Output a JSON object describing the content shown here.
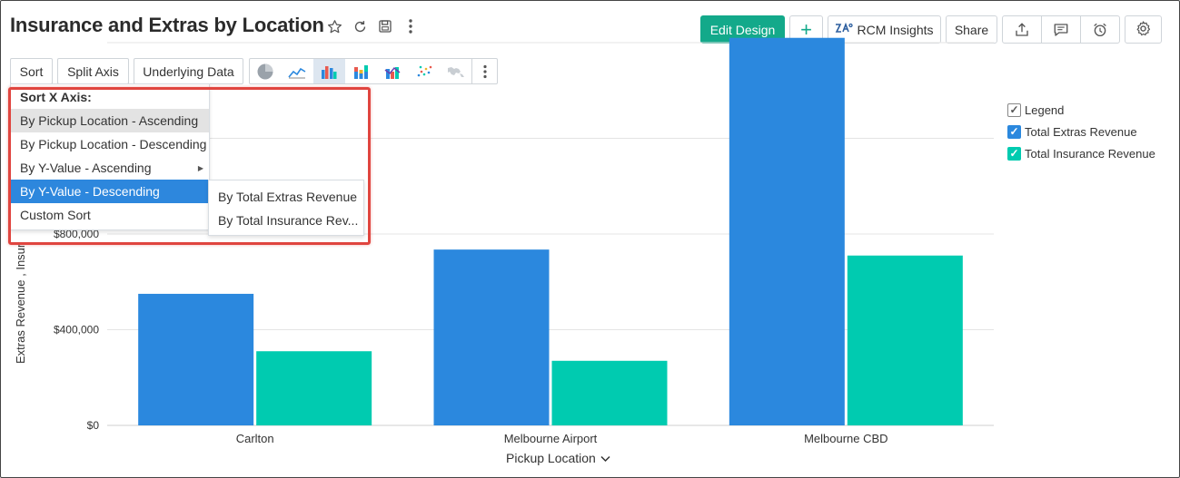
{
  "header": {
    "title": "Insurance and Extras by Location",
    "edit_design": "Edit Design",
    "add_label": "+",
    "rcm_insights": "RCM Insights",
    "share": "Share"
  },
  "toolbar": {
    "sort": "Sort",
    "split_axis": "Split Axis",
    "underlying_data": "Underlying Data"
  },
  "sort_menu": {
    "header": "Sort X Axis:",
    "items": [
      "By Pickup Location - Ascending",
      "By Pickup Location - Descending",
      "By Y-Value - Ascending",
      "By Y-Value - Descending",
      "Custom Sort"
    ],
    "submenu": [
      "By Total Extras Revenue",
      "By Total Insurance Rev..."
    ]
  },
  "legend": {
    "title": "Legend",
    "items": [
      "Total Extras Revenue",
      "Total Insurance Revenue"
    ]
  },
  "colors": {
    "accent": "#13a98a",
    "extras": "#2b88de",
    "insurance": "#00cbb0",
    "highlight": "#e0453f"
  },
  "chart_data": {
    "type": "bar",
    "categories": [
      "Carlton",
      "Melbourne Airport",
      "Melbourne CBD"
    ],
    "series": [
      {
        "name": "Total Extras Revenue",
        "values": [
          550000,
          735000,
          1620000
        ]
      },
      {
        "name": "Total Insurance Revenue",
        "values": [
          310000,
          270000,
          710000
        ]
      }
    ],
    "xlabel": "Pickup Location",
    "ylabel": "Extras Revenue , Insur",
    "yticks": [
      "$0",
      "$400,000",
      "$800,000"
    ],
    "ytick_values": [
      0,
      400000,
      800000
    ],
    "ylim": [
      0,
      1600000
    ],
    "grid": true,
    "legend_position": "right"
  }
}
